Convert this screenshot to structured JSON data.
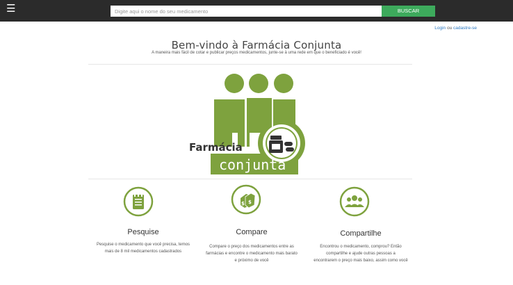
{
  "header": {
    "menu_icon": "hamburger-icon",
    "search_placeholder": "Digite aqui o nome do seu medicamento",
    "search_button": "BUSCAR",
    "accent_color": "#3daa5c"
  },
  "auth": {
    "login": "Login",
    "separator": "ou",
    "register": "cadastre-se"
  },
  "hero": {
    "title": "Bem-vindo à Farmácia Conjunta",
    "subtitle": "A maneira mais fácil de cotar e publicar preços medicamentos, junte-se à  uma rede em que o beneficiado é você!"
  },
  "logo": {
    "word1": "Farmácia",
    "word2": "conjunta",
    "brand_color": "#7ea23e"
  },
  "features": [
    {
      "icon": "notepad-icon",
      "title": "Pesquise",
      "desc_lines": [
        "Pesquise o medicamento que você precisa, temos",
        "mais de 8 mil medicamentos cadastrados"
      ]
    },
    {
      "icon": "price-tags-icon",
      "title": "Compare",
      "desc_lines": [
        "Compare o preço dos medicamentos entre as",
        "farmácias e encontre o medicamento mais barato",
        "e próximo de você"
      ]
    },
    {
      "icon": "people-group-icon",
      "title": "Compartilhe",
      "desc_lines": [
        "Encontrou o medicamento, comprou? Então",
        "compartilhe e ajude outras pessoas a",
        "encontrarem o preço mais baixo, assim como você"
      ]
    }
  ]
}
